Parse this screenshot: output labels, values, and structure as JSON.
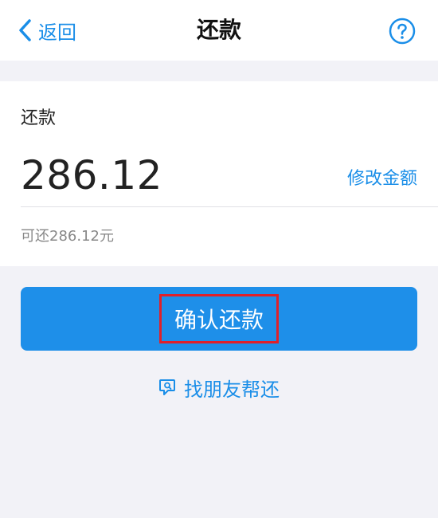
{
  "navbar": {
    "back_label": "返回",
    "title": "还款",
    "back_icon": "chevron-left-icon",
    "help_icon": "question-circle-icon"
  },
  "repay": {
    "label": "还款",
    "amount": "286.12",
    "modify_label": "修改金额",
    "available_text": "可还286.12元"
  },
  "actions": {
    "confirm_label": "确认还款",
    "friend_label": "找朋友帮还",
    "friend_icon": "chat-help-icon"
  },
  "colors": {
    "accent": "#1a8ee8",
    "button": "#1e8fe9",
    "highlight": "#e0202a",
    "background": "#f2f2f7"
  }
}
